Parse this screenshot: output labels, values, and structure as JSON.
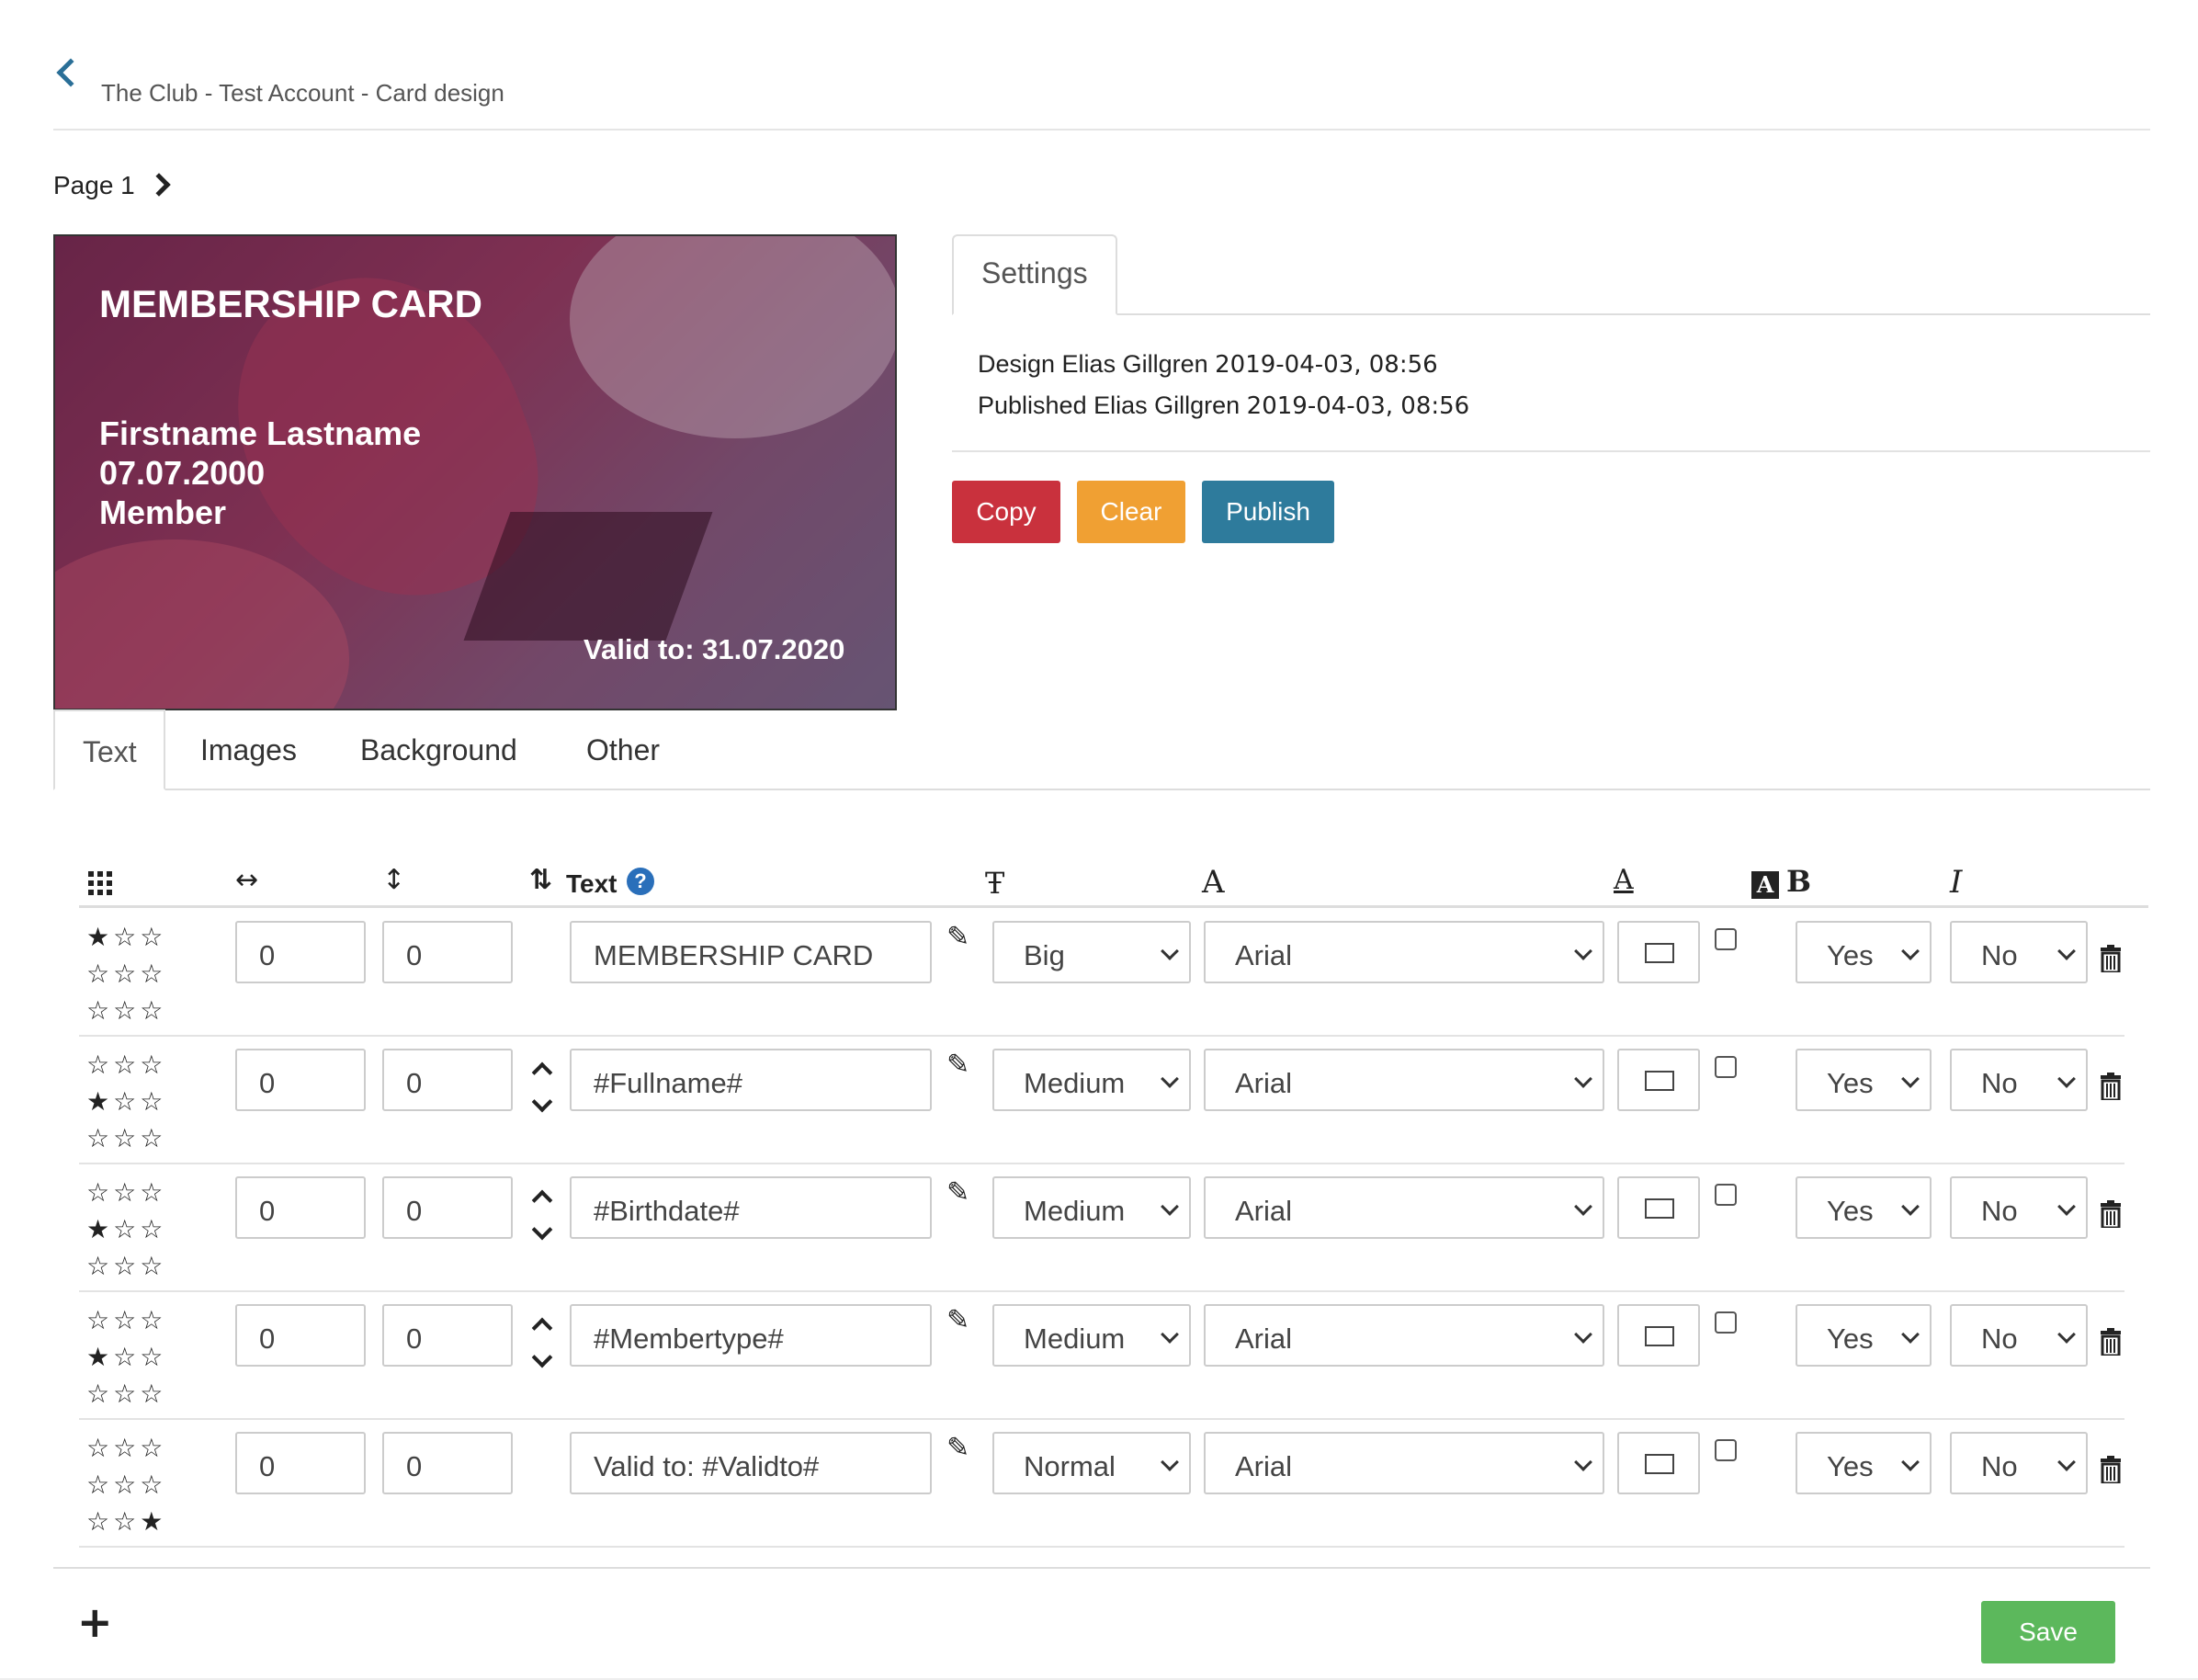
{
  "header": {
    "breadcrumb": "The Club - Test Account - Card design"
  },
  "pager": {
    "label": "Page 1"
  },
  "card_preview": {
    "title": "MEMBERSHIP CARD",
    "lines": [
      "Firstname Lastname",
      "07.07.2000",
      "Member"
    ],
    "valid": "Valid to: 31.07.2020"
  },
  "settings": {
    "tab_label": "Settings",
    "design_label": "Design Elias Gillgren",
    "design_time": "2019-04-03, 08:56",
    "published_label": "Published Elias Gillgren",
    "published_time": "2019-04-03, 08:56"
  },
  "actions": {
    "copy": "Copy",
    "clear": "Clear",
    "publish": "Publish"
  },
  "tabs": [
    {
      "label": "Text",
      "active": true
    },
    {
      "label": "Images"
    },
    {
      "label": "Background"
    },
    {
      "label": "Other"
    }
  ],
  "table": {
    "text_header": "Text",
    "rows": [
      {
        "stars": "★☆☆\n☆☆☆\n☆☆☆",
        "x": "0",
        "y": "0",
        "has_order_arrows": false,
        "text": "MEMBERSHIP CARD",
        "size": "Big",
        "font": "Arial",
        "bold": "Yes",
        "italic": "No"
      },
      {
        "stars": "☆☆☆\n★☆☆\n☆☆☆",
        "x": "0",
        "y": "0",
        "has_order_arrows": true,
        "text": "#Fullname#",
        "size": "Medium",
        "font": "Arial",
        "bold": "Yes",
        "italic": "No"
      },
      {
        "stars": "☆☆☆\n★☆☆\n☆☆☆",
        "x": "0",
        "y": "0",
        "has_order_arrows": true,
        "text": "#Birthdate#",
        "size": "Medium",
        "font": "Arial",
        "bold": "Yes",
        "italic": "No"
      },
      {
        "stars": "☆☆☆\n★☆☆\n☆☆☆",
        "x": "0",
        "y": "0",
        "has_order_arrows": true,
        "text": "#Membertype#",
        "size": "Medium",
        "font": "Arial",
        "bold": "Yes",
        "italic": "No"
      },
      {
        "stars": "☆☆☆\n☆☆☆\n☆☆★",
        "x": "0",
        "y": "0",
        "has_order_arrows": false,
        "text": "Valid to: #Validto#",
        "size": "Normal",
        "font": "Arial",
        "bold": "Yes",
        "italic": "No"
      }
    ]
  },
  "footer": {
    "save": "Save"
  },
  "colors": {
    "copy": "#c9313d",
    "clear": "#f0a033",
    "publish": "#2e7b9c",
    "save": "#5cb85c",
    "link": "#2a6f97"
  }
}
